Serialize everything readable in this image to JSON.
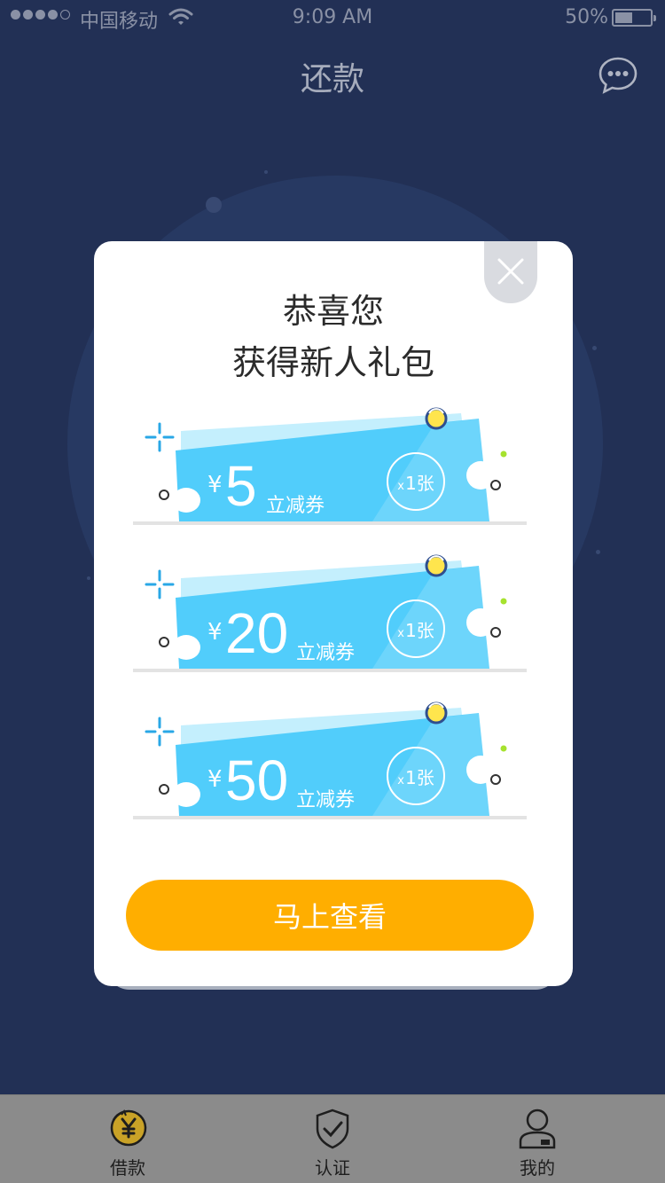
{
  "status_bar": {
    "carrier": "中国移动",
    "time": "9:09 AM",
    "battery": "50%",
    "battery_level": 0.5,
    "signal_bars": 4
  },
  "nav": {
    "title": "还款",
    "chat_icon": "chat-bubble-icon"
  },
  "modal": {
    "close_icon": "close-icon",
    "title_line1": "恭喜您",
    "title_line2": "获得新人礼包",
    "coupons": [
      {
        "currency": "¥",
        "amount": "5",
        "label": "立减券",
        "qty_prefix": "x",
        "qty": "1张"
      },
      {
        "currency": "¥",
        "amount": "20",
        "label": "立减券",
        "qty_prefix": "x",
        "qty": "1张"
      },
      {
        "currency": "¥",
        "amount": "50",
        "label": "立减券",
        "qty_prefix": "x",
        "qty": "1张"
      }
    ],
    "cta_label": "马上查看"
  },
  "tab_bar": {
    "items": [
      {
        "label": "借款",
        "icon": "yen-coin-icon",
        "active": true
      },
      {
        "label": "认证",
        "icon": "shield-check-icon",
        "active": false
      },
      {
        "label": "我的",
        "icon": "user-profile-icon",
        "active": false
      }
    ]
  },
  "colors": {
    "background": "#26365f",
    "accent": "#ffae00",
    "coupon": "#51cdfb",
    "coupon_light": "#c4effd"
  }
}
